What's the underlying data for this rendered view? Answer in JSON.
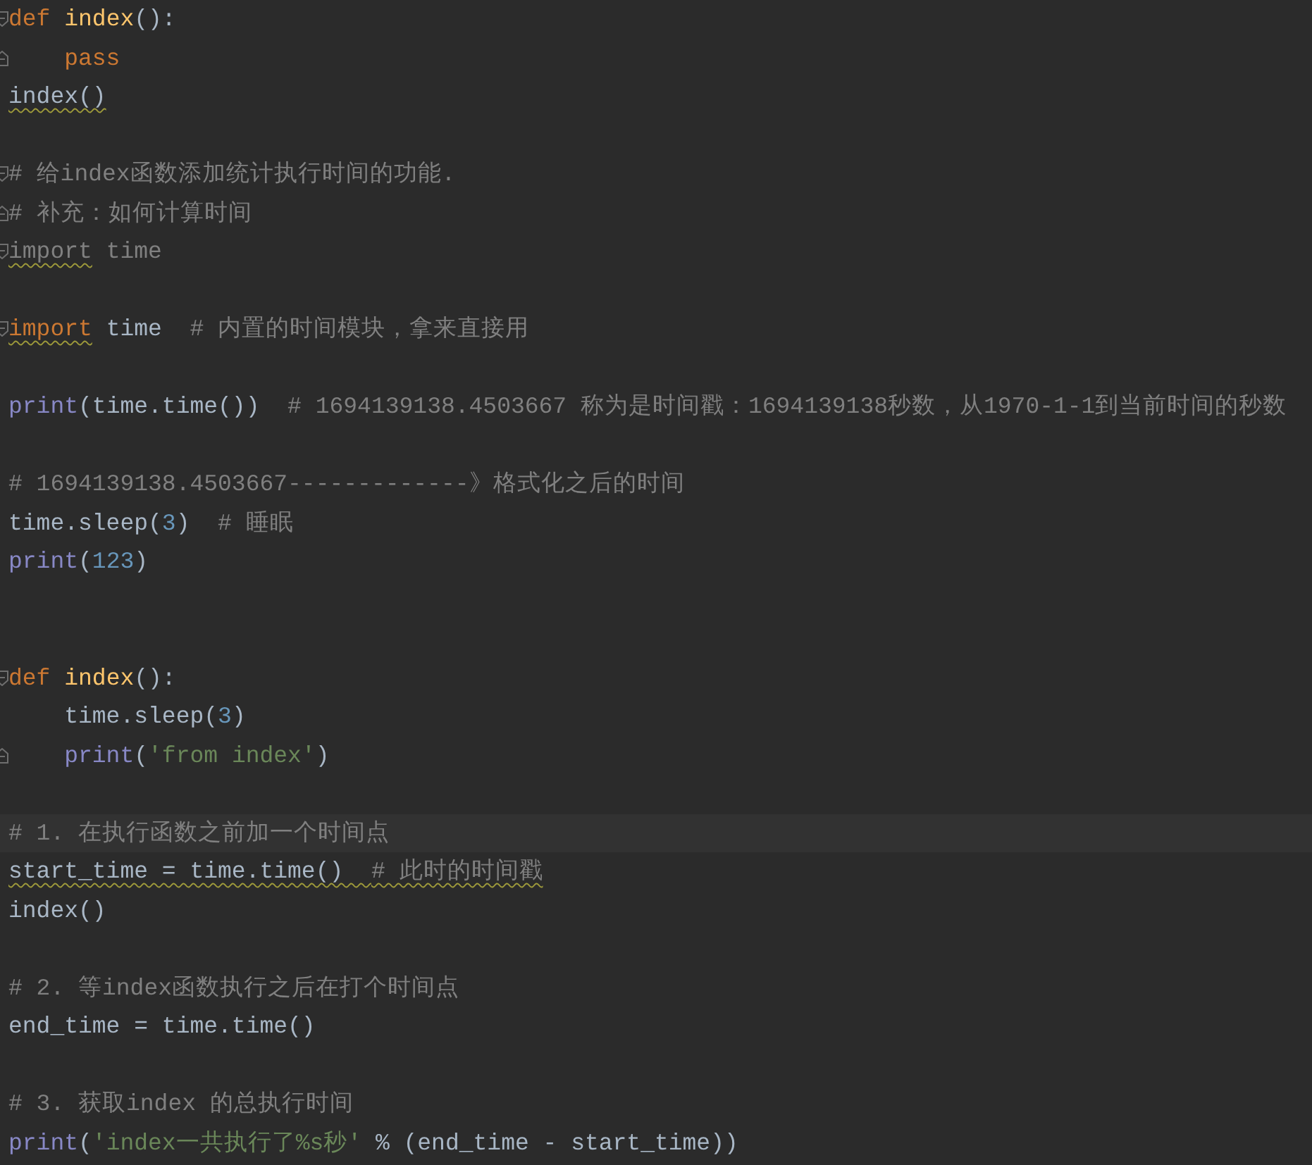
{
  "editor": {
    "lines": [
      {
        "kind": "code",
        "fold_start": true,
        "tokens": [
          {
            "kind": "keyword",
            "text": "def "
          },
          {
            "kind": "funcname",
            "text": "index"
          },
          {
            "kind": "plain",
            "text": "():"
          }
        ]
      },
      {
        "kind": "code",
        "fold_end": true,
        "tokens": [
          {
            "kind": "keyword",
            "text": "    pass"
          }
        ]
      },
      {
        "kind": "code",
        "tokens": [
          {
            "kind": "plain",
            "text": "index()",
            "underlined": true
          }
        ]
      },
      {
        "kind": "blank"
      },
      {
        "kind": "code",
        "fold_start": true,
        "tokens": [
          {
            "kind": "comment",
            "text": "# 给index函数添加统计执行时间的功能."
          }
        ]
      },
      {
        "kind": "code",
        "fold_end": true,
        "tokens": [
          {
            "kind": "comment",
            "text": "# 补充：如何计算时间"
          }
        ]
      },
      {
        "kind": "code",
        "fold_start": true,
        "tokens": [
          {
            "kind": "unused",
            "text": "import",
            "underlined": true
          },
          {
            "kind": "unused",
            "text": " time"
          }
        ]
      },
      {
        "kind": "blank"
      },
      {
        "kind": "code",
        "fold_start": true,
        "tokens": [
          {
            "kind": "keyword",
            "text": "import",
            "underlined": true
          },
          {
            "kind": "plain",
            "text": " time  "
          },
          {
            "kind": "comment",
            "text": "# 内置的时间模块，拿来直接用"
          }
        ]
      },
      {
        "kind": "blank"
      },
      {
        "kind": "code",
        "tokens": [
          {
            "kind": "builtin",
            "text": "print"
          },
          {
            "kind": "plain",
            "text": "(time.time())  "
          },
          {
            "kind": "comment",
            "text": "# 1694139138.4503667 称为是时间戳：1694139138秒数，从1970-1-1到当前时间的秒数"
          }
        ]
      },
      {
        "kind": "blank"
      },
      {
        "kind": "code",
        "tokens": [
          {
            "kind": "comment",
            "text": "# 1694139138.4503667-------------》格式化之后的时间"
          }
        ]
      },
      {
        "kind": "code",
        "tokens": [
          {
            "kind": "plain",
            "text": "time.sleep("
          },
          {
            "kind": "number",
            "text": "3"
          },
          {
            "kind": "plain",
            "text": ")  "
          },
          {
            "kind": "comment",
            "text": "# 睡眠"
          }
        ]
      },
      {
        "kind": "code",
        "tokens": [
          {
            "kind": "builtin",
            "text": "print"
          },
          {
            "kind": "plain",
            "text": "("
          },
          {
            "kind": "number",
            "text": "123"
          },
          {
            "kind": "plain",
            "text": ")"
          }
        ]
      },
      {
        "kind": "blank"
      },
      {
        "kind": "blank"
      },
      {
        "kind": "code",
        "fold_start": true,
        "tokens": [
          {
            "kind": "keyword",
            "text": "def "
          },
          {
            "kind": "funcname",
            "text": "index"
          },
          {
            "kind": "plain",
            "text": "():"
          }
        ]
      },
      {
        "kind": "code",
        "tokens": [
          {
            "kind": "plain",
            "text": "    time.sleep("
          },
          {
            "kind": "number",
            "text": "3"
          },
          {
            "kind": "plain",
            "text": ")"
          }
        ]
      },
      {
        "kind": "code",
        "fold_end": true,
        "tokens": [
          {
            "kind": "builtin",
            "text": "    print"
          },
          {
            "kind": "plain",
            "text": "("
          },
          {
            "kind": "string",
            "text": "'from index'"
          },
          {
            "kind": "plain",
            "text": ")"
          }
        ]
      },
      {
        "kind": "blank"
      },
      {
        "kind": "code",
        "current": true,
        "tokens": [
          {
            "kind": "comment",
            "text": "# 1. 在执行函数之前加一个时间点"
          }
        ]
      },
      {
        "kind": "code",
        "tokens": [
          {
            "kind": "plain",
            "text": "start_time = time.time()  ",
            "underlined": true
          },
          {
            "kind": "comment",
            "text": "# 此时的时间戳",
            "underlined": true
          }
        ]
      },
      {
        "kind": "code",
        "tokens": [
          {
            "kind": "plain",
            "text": "index()"
          }
        ]
      },
      {
        "kind": "blank"
      },
      {
        "kind": "code",
        "tokens": [
          {
            "kind": "comment",
            "text": "# 2. 等index函数执行之后在打个时间点"
          }
        ]
      },
      {
        "kind": "code",
        "tokens": [
          {
            "kind": "plain",
            "text": "end_time = time.time()"
          }
        ]
      },
      {
        "kind": "blank"
      },
      {
        "kind": "code",
        "tokens": [
          {
            "kind": "comment",
            "text": "# 3. 获取index 的总执行时间"
          }
        ]
      },
      {
        "kind": "code",
        "tokens": [
          {
            "kind": "builtin",
            "text": "print"
          },
          {
            "kind": "plain",
            "text": "("
          },
          {
            "kind": "string",
            "text": "'index一共执行了%s秒'"
          },
          {
            "kind": "plain",
            "text": " % (end_time - start_time))"
          }
        ]
      }
    ]
  }
}
